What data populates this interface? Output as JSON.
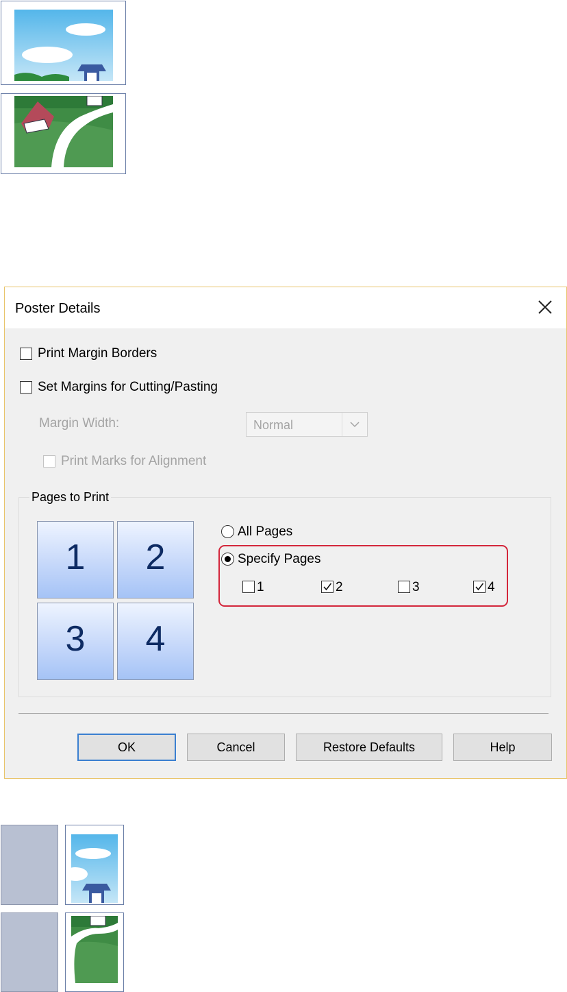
{
  "colors": {
    "accent": "#3a7fd0",
    "highlight": "#d3263b",
    "dialog_border": "#e8c46a"
  },
  "illustrations": [
    {
      "name": "sky-upper-half",
      "icon": "poster-top-half-image"
    },
    {
      "name": "field-lower-half",
      "icon": "poster-bottom-half-image"
    },
    {
      "name": "printed-page-2",
      "icon": "printed-page-top-right"
    },
    {
      "name": "printed-page-4",
      "icon": "printed-page-bottom-right"
    }
  ],
  "dialog": {
    "title": "Poster Details",
    "close_icon": "close-icon",
    "print_margin_borders": {
      "label": "Print Margin Borders",
      "checked": false
    },
    "set_margins": {
      "label": "Set Margins for Cutting/Pasting",
      "checked": false
    },
    "margin_width": {
      "label": "Margin Width:",
      "value": "Normal",
      "enabled": false
    },
    "print_marks": {
      "label": "Print Marks for Alignment",
      "checked": false,
      "enabled": false
    },
    "pages_group": {
      "label": "Pages to Print",
      "tiles": [
        "1",
        "2",
        "3",
        "4"
      ],
      "all_pages": {
        "label": "All Pages",
        "selected": false
      },
      "specify_pages": {
        "label": "Specify Pages",
        "selected": true
      },
      "pages": [
        {
          "label": "1",
          "checked": false
        },
        {
          "label": "2",
          "checked": true
        },
        {
          "label": "3",
          "checked": false
        },
        {
          "label": "4",
          "checked": true
        }
      ]
    },
    "buttons": {
      "ok": "OK",
      "cancel": "Cancel",
      "restore": "Restore Defaults",
      "help": "Help"
    }
  }
}
